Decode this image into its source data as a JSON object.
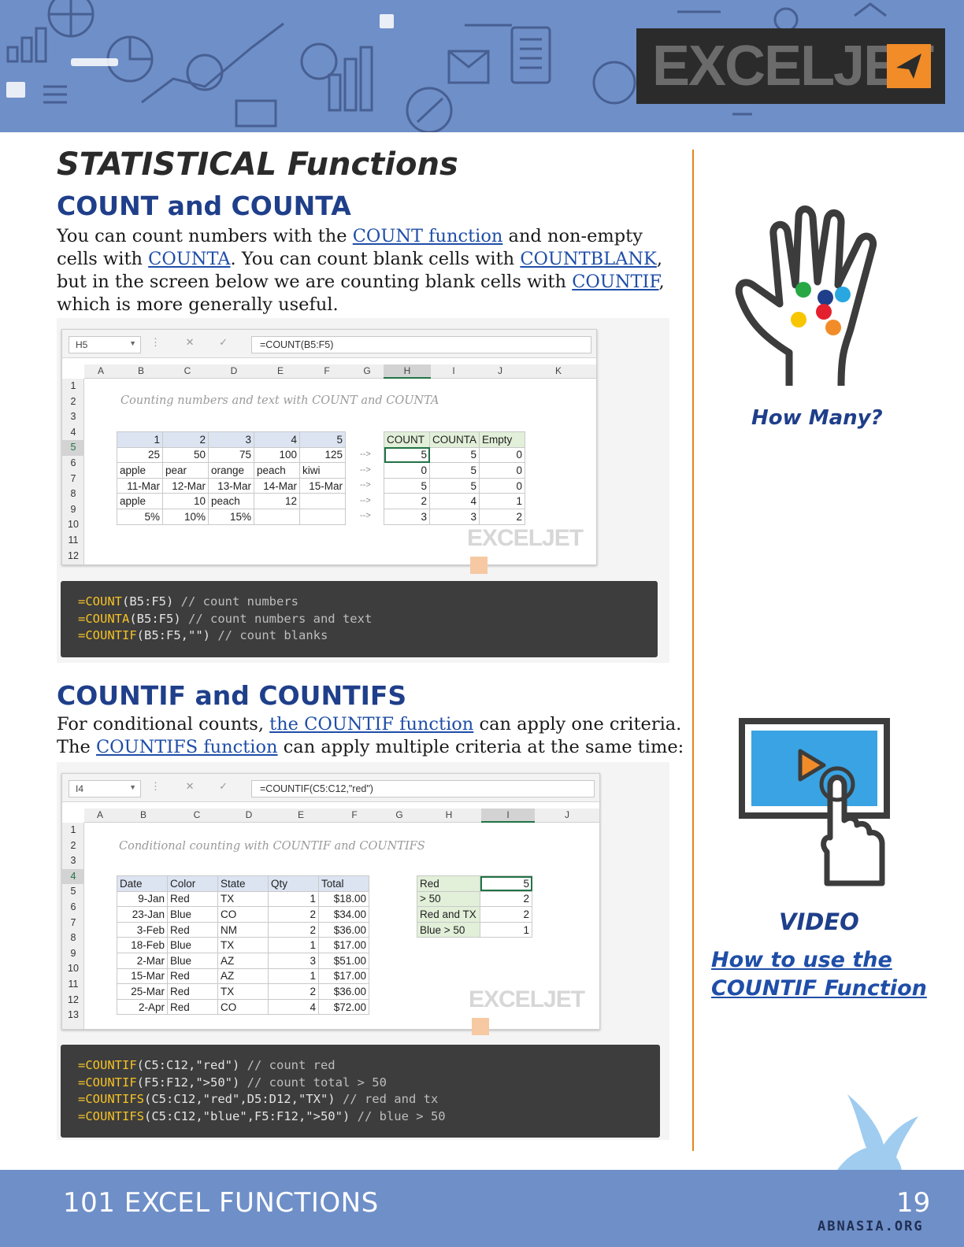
{
  "banner": {
    "logo_text": "EXCELJET"
  },
  "page": {
    "title": "STATISTICAL Functions",
    "section1": {
      "heading": "COUNT and COUNTA",
      "p1": "You can count numbers with the ",
      "link1": "COUNT function",
      "p2": " and non-empty cells with ",
      "link2": "COUNTA",
      "p3": ". You can count blank cells with ",
      "link3": "COUNTBLANK",
      "p4": ", but in the screen below we are counting blank cells with ",
      "link4": "COUNTIF",
      "p5": ", which is more generally useful."
    },
    "section2": {
      "heading": "COUNTIF and COUNTIFS",
      "p1": "For conditional counts, ",
      "link1": "the COUNTIF function",
      "p2": " can apply one criteria. The ",
      "link2": "COUNTIFS function",
      "p3": " can apply multiple criteria at the same time:"
    }
  },
  "sheet1": {
    "namebox": "H5",
    "formula": "=COUNT(B5:F5)",
    "columns": [
      "A",
      "B",
      "C",
      "D",
      "E",
      "F",
      "G",
      "H",
      "I",
      "J",
      "K"
    ],
    "rows": [
      "1",
      "2",
      "3",
      "4",
      "5",
      "6",
      "7",
      "8",
      "9",
      "10",
      "11",
      "12"
    ],
    "title": "Counting numbers and text with COUNT and COUNTA",
    "data": [
      [
        "1",
        "2",
        "3",
        "4",
        "5"
      ],
      [
        "25",
        "50",
        "75",
        "100",
        "125"
      ],
      [
        "apple",
        "pear",
        "orange",
        "peach",
        "kiwi"
      ],
      [
        "11-Mar",
        "12-Mar",
        "13-Mar",
        "14-Mar",
        "15-Mar"
      ],
      [
        "apple",
        "10",
        "peach",
        "12",
        ""
      ],
      [
        "5%",
        "10%",
        "15%",
        "",
        ""
      ]
    ],
    "arrow": "-->",
    "result_headers": [
      "COUNT",
      "COUNTA",
      "Empty"
    ],
    "results": [
      [
        "5",
        "5",
        "0"
      ],
      [
        "0",
        "5",
        "0"
      ],
      [
        "5",
        "5",
        "0"
      ],
      [
        "2",
        "4",
        "1"
      ],
      [
        "3",
        "3",
        "2"
      ]
    ],
    "watermark": "EXCELJET"
  },
  "code1": [
    {
      "eq": "=",
      "fn": "COUNT",
      "args": "(B5:F5)",
      "comment": " // count numbers"
    },
    {
      "eq": "=",
      "fn": "COUNTA",
      "args": "(B5:F5)",
      "comment": " // count numbers and text"
    },
    {
      "eq": "=",
      "fn": "COUNTIF",
      "args": "(B5:F5,\"\")",
      "comment": " // count blanks"
    }
  ],
  "sheet2": {
    "namebox": "I4",
    "formula": "=COUNTIF(C5:C12,\"red\")",
    "columns": [
      "A",
      "B",
      "C",
      "D",
      "E",
      "F",
      "G",
      "H",
      "I",
      "J"
    ],
    "rows": [
      "1",
      "2",
      "3",
      "4",
      "5",
      "6",
      "7",
      "8",
      "9",
      "10",
      "11",
      "12",
      "13"
    ],
    "title": "Conditional counting with COUNTIF and COUNTIFS",
    "headers": [
      "Date",
      "Color",
      "State",
      "Qty",
      "Total"
    ],
    "data": [
      [
        "9-Jan",
        "Red",
        "TX",
        "1",
        "$18.00"
      ],
      [
        "23-Jan",
        "Blue",
        "CO",
        "2",
        "$34.00"
      ],
      [
        "3-Feb",
        "Red",
        "NM",
        "2",
        "$36.00"
      ],
      [
        "18-Feb",
        "Blue",
        "TX",
        "1",
        "$17.00"
      ],
      [
        "2-Mar",
        "Blue",
        "AZ",
        "3",
        "$51.00"
      ],
      [
        "15-Mar",
        "Red",
        "AZ",
        "1",
        "$17.00"
      ],
      [
        "25-Mar",
        "Red",
        "TX",
        "2",
        "$36.00"
      ],
      [
        "2-Apr",
        "Red",
        "CO",
        "4",
        "$72.00"
      ]
    ],
    "summary": [
      [
        "Red",
        "5"
      ],
      [
        "> 50",
        "2"
      ],
      [
        "Red and TX",
        "2"
      ],
      [
        "Blue > 50",
        "1"
      ]
    ],
    "watermark": "EXCELJET"
  },
  "code2": [
    {
      "eq": "=",
      "fn": "COUNTIF",
      "args": "(C5:C12,\"red\")",
      "comment": " // count red"
    },
    {
      "eq": "=",
      "fn": "COUNTIF",
      "args": "(F5:F12,\">50\")",
      "comment": " // count total > 50"
    },
    {
      "eq": "=",
      "fn": "COUNTIFS",
      "args": "(C5:C12,\"red\",D5:D12,\"TX\")",
      "comment": " // red and tx"
    },
    {
      "eq": "=",
      "fn": "COUNTIFS",
      "args": "(C5:C12,\"blue\",F5:F12,\">50\")",
      "comment": " // blue > 50"
    }
  ],
  "sidebar": {
    "how_many": "How Many?",
    "video_label": "VIDEO",
    "video_link": "How to use the COUNTIF Function"
  },
  "footer": {
    "title": "101 EXCEL FUNCTIONS",
    "page_number": "19",
    "site": "ABNASIA.ORG"
  },
  "colors": {
    "banner": "#6f8fc8",
    "heading": "#1f3f8a",
    "link": "#1f4ea8",
    "divider": "#e4861f",
    "code_bg": "#3d3d3d",
    "code_fn": "#f5c227"
  }
}
